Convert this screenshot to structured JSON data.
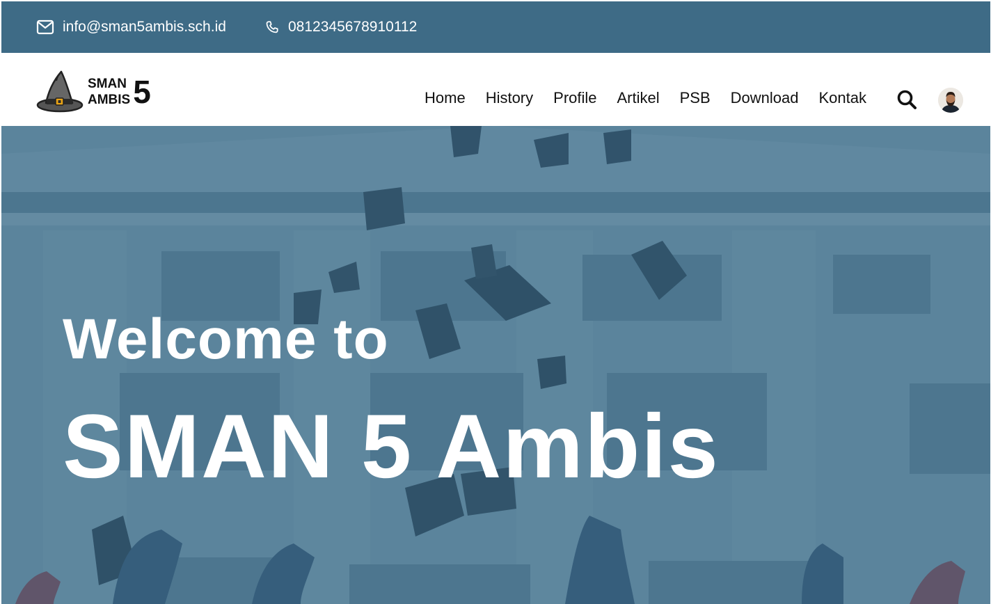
{
  "topbar": {
    "email": "info@sman5ambis.sch.id",
    "phone": "0812345678910112",
    "bg_color": "#3e6b86"
  },
  "brand": {
    "line1": "SMAN",
    "line2": "AMBIS",
    "number": "5"
  },
  "nav": {
    "items": [
      "Home",
      "History",
      "Profile",
      "Artikel",
      "PSB",
      "Download",
      "Kontak"
    ]
  },
  "icons": {
    "email": "mail-icon",
    "phone": "phone-icon",
    "search": "search-icon",
    "avatar": "user-avatar",
    "logo": "wizard-hat-icon"
  },
  "hero": {
    "line1": "Welcome to",
    "line2": "SMAN 5 Ambis",
    "overlay_color": "#3e6b86"
  }
}
